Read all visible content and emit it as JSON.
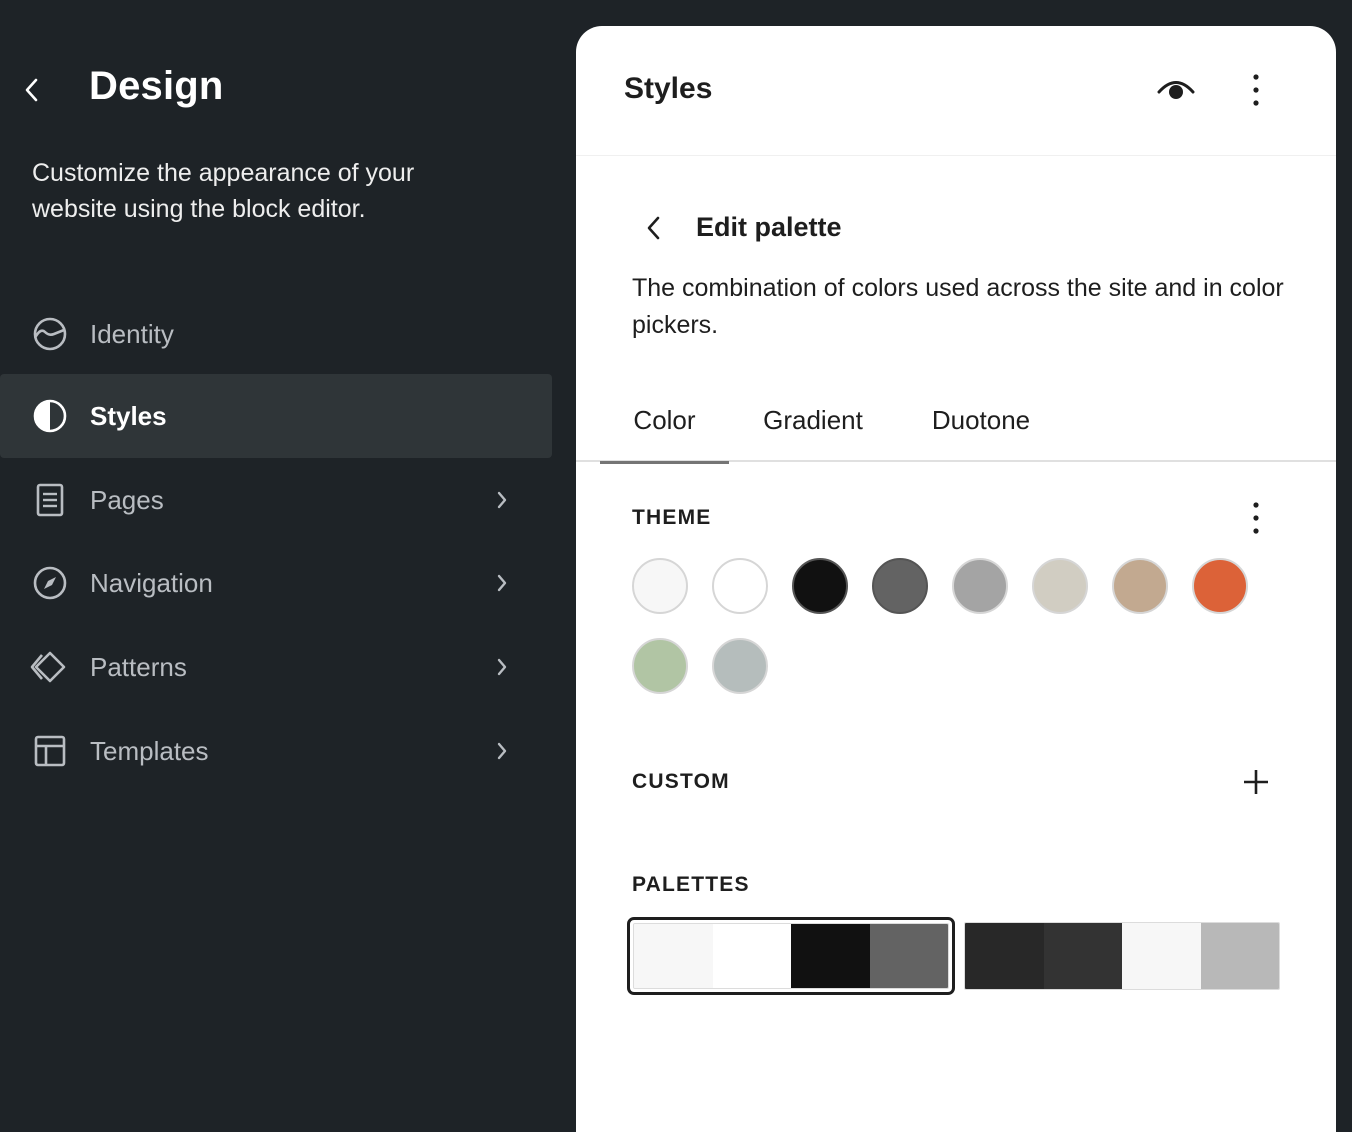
{
  "sidebar": {
    "title": "Design",
    "description": "Customize the appearance of your website using the block editor.",
    "items": [
      {
        "label": "Identity",
        "icon": "identity-icon",
        "has_chevron": false,
        "active": false
      },
      {
        "label": "Styles",
        "icon": "styles-icon",
        "has_chevron": false,
        "active": true
      },
      {
        "label": "Pages",
        "icon": "pages-icon",
        "has_chevron": true,
        "active": false
      },
      {
        "label": "Navigation",
        "icon": "navigation-icon",
        "has_chevron": true,
        "active": false
      },
      {
        "label": "Patterns",
        "icon": "patterns-icon",
        "has_chevron": true,
        "active": false
      },
      {
        "label": "Templates",
        "icon": "templates-icon",
        "has_chevron": true,
        "active": false
      }
    ]
  },
  "panel": {
    "title": "Styles",
    "icons": {
      "preview": "eye-icon",
      "more": "more-vertical-icon"
    },
    "subpage": {
      "title": "Edit palette",
      "description": "The combination of colors used across the site and in color pickers."
    },
    "tabs": [
      {
        "label": "Color",
        "active": true
      },
      {
        "label": "Gradient",
        "active": false
      },
      {
        "label": "Duotone",
        "active": false
      }
    ],
    "theme": {
      "label": "THEME",
      "colors": [
        "#f7f7f7",
        "#ffffff",
        "#111111",
        "#636363",
        "#a4a4a4",
        "#d1cdc2",
        "#c2a990",
        "#dc6238",
        "#b1c5a4",
        "#b5bdbc"
      ]
    },
    "custom": {
      "label": "CUSTOM"
    },
    "palettes": {
      "label": "PALETTES",
      "items": [
        {
          "colors": [
            "#f7f7f7",
            "#ffffff",
            "#111111",
            "#636363"
          ],
          "selected": true
        },
        {
          "colors": [
            "#282828",
            "#333333",
            "#f7f7f7",
            "#b8b8b8"
          ],
          "selected": false
        }
      ]
    }
  },
  "colors": {
    "sidebar_bg": "#1e2327",
    "sidebar_active_bg": "#2f3538",
    "panel_bg": "#ffffff",
    "text_dark": "#1e1e1e"
  }
}
